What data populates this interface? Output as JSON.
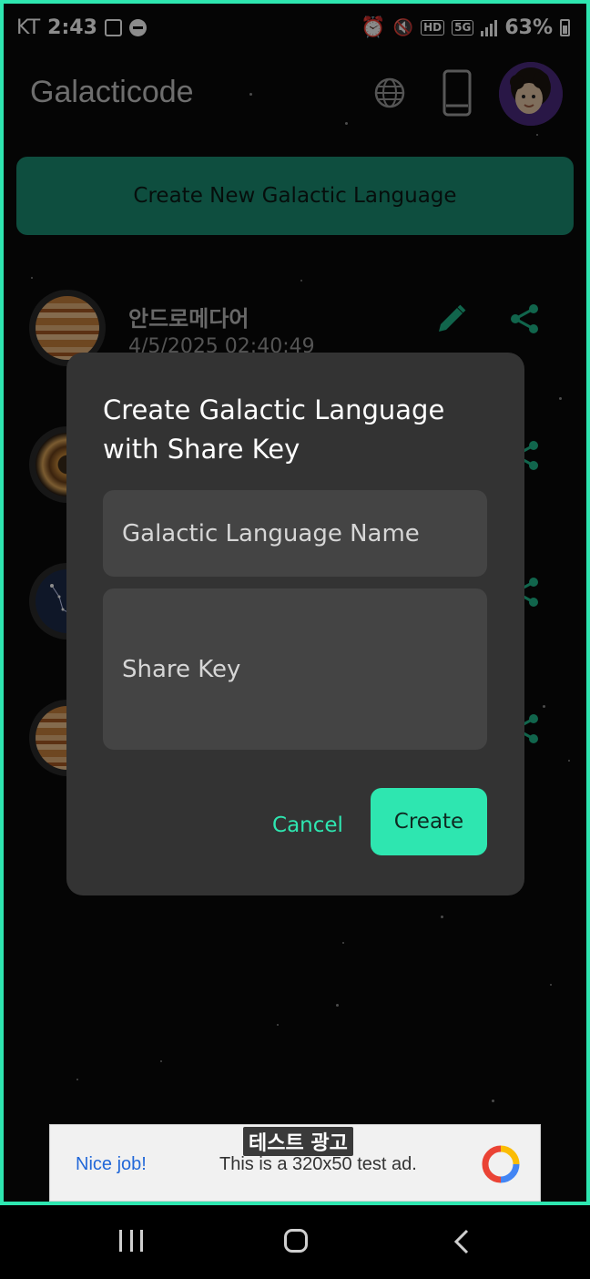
{
  "status_bar": {
    "carrier": "KT",
    "time": "2:43",
    "network": "5G",
    "hd_badge": "HD",
    "battery": "63%"
  },
  "app_bar": {
    "title": "Galacticode",
    "icons": [
      "globe-icon",
      "phone-icon",
      "avatar"
    ]
  },
  "create_button_label": "Create New Galactic Language",
  "list": {
    "first_item": {
      "title": "안드로메다어",
      "date": "4/5/2025 02:40:49"
    },
    "planet_icons": [
      "jupiter-planet-icon",
      "saturn-planet-icon",
      "constellation-planet-icon",
      "jupiter-planet-icon"
    ]
  },
  "dialog": {
    "title": "Create Galactic Language with Share Key",
    "name_placeholder": "Galactic Language Name",
    "key_placeholder": "Share Key",
    "cancel_label": "Cancel",
    "create_label": "Create"
  },
  "ad": {
    "label": "테스트 광고",
    "nice": "Nice job!",
    "text": "This is a 320x50 test ad."
  },
  "colors": {
    "accent": "#2ee6b0",
    "accent_dim": "#1b8f74",
    "dialog_bg": "#333333",
    "field_bg": "#444444"
  }
}
